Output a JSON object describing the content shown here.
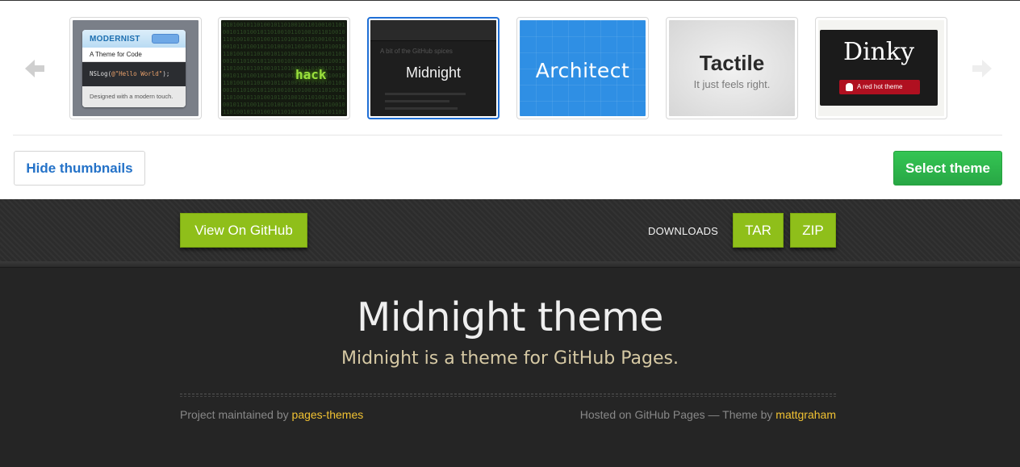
{
  "chooser": {
    "thumbnails": [
      {
        "name": "Modernist",
        "heading": "MODERNIST",
        "tagline": "A Theme for Code",
        "code_prefix": "NSLog(",
        "code_string": "@\"Hello World\"",
        "code_suffix": ");",
        "footer": "Designed with a modern touch.",
        "selected": false
      },
      {
        "name": "hack",
        "label": "hack",
        "selected": false
      },
      {
        "name": "Midnight",
        "label": "Midnight",
        "blurb": "A bit of the GitHub spices",
        "selected": true
      },
      {
        "name": "Architect",
        "label": "Architect",
        "selected": false
      },
      {
        "name": "Tactile",
        "label": "Tactile",
        "sub": "It just feels right.",
        "selected": false
      },
      {
        "name": "Dinky",
        "label": "Dinky",
        "badge": "A red hot theme",
        "selected": false
      }
    ],
    "hide_label": "Hide thumbnails",
    "select_label": "Select theme"
  },
  "header": {
    "github_label": "View On GitHub",
    "downloads_label": "DOWNLOADS",
    "tar_label": "TAR",
    "zip_label": "ZIP"
  },
  "main": {
    "title": "Midnight theme",
    "subtitle": "Midnight is a theme for GitHub Pages."
  },
  "footer": {
    "left_text": "Project maintained by",
    "left_link": "pages-themes",
    "right_text": "Hosted on GitHub Pages — Theme by",
    "right_link": "mattgraham"
  },
  "colors": {
    "accent_blue": "#1f6fd6",
    "select_green": "#28a745",
    "midnight_green": "#8fbf1a",
    "link_yellow": "#f1c232"
  }
}
